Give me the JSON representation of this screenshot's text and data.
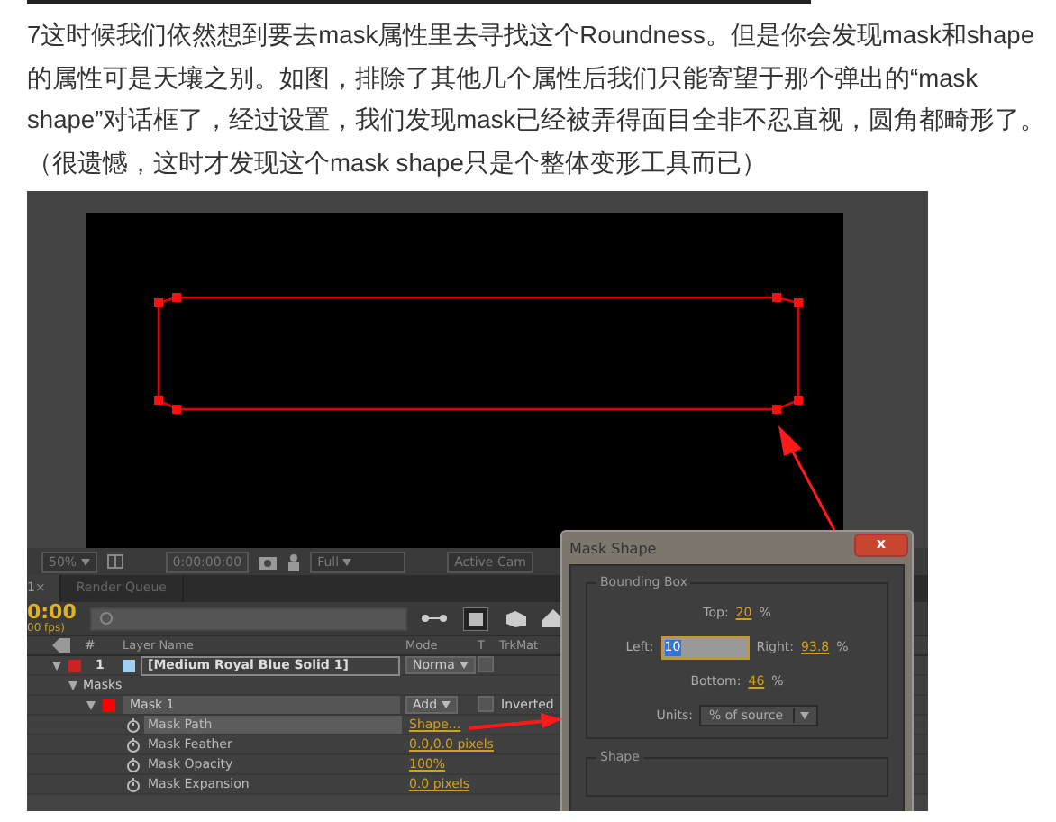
{
  "post": {
    "paragraphs": [
      "7这时候我们依然想到要去mask属性里去寻找这个Roundness。但是你会发现mask和shape的属性可是天壤之别。如图，排除了其他几个属性后我们只能寄望于那个弹出的“mask shape”对话框了，经过设置，我们发现mask已经被弄得面目全非不忍直视，圆角都畸形了。",
      "（很遗憾，这时才发现这个mask shape只是个整体变形工具而已）"
    ]
  },
  "screenshot": {
    "viewer_toolbar": {
      "zoom": "50%",
      "timecode": "0:00:00:00",
      "resolution": "Full",
      "camera": "Active Cam"
    },
    "tabs": [
      {
        "label": "1",
        "close": "×",
        "selected": true
      },
      {
        "label": "Render Queue",
        "selected": false
      }
    ],
    "timecode": "0:00",
    "fps": "00 fps)",
    "columns": [
      "#",
      "Layer Name",
      "Mode",
      "T",
      "TrkMat"
    ],
    "rows": [
      {
        "kind": "layer",
        "number": "1",
        "name": "[Medium Royal Blue Solid 1]",
        "mode": "Norma",
        "color": "#cc2222",
        "expanded": true,
        "selected": false,
        "checked": false
      },
      {
        "kind": "group",
        "name": "Masks",
        "expanded": true,
        "selected": false
      },
      {
        "kind": "mask",
        "name": "Mask 1",
        "mode": "Add",
        "option": "Inverted",
        "color": "#ff0000",
        "expanded": true,
        "selected": false,
        "checked": false
      },
      {
        "kind": "property",
        "name": "Mask Path",
        "value": "Shape...",
        "selected": true
      },
      {
        "kind": "property",
        "name": "Mask Feather",
        "value": "0.0,0.0 pixels",
        "selected": false
      },
      {
        "kind": "property",
        "name": "Mask Opacity",
        "value": "100%",
        "selected": false
      },
      {
        "kind": "property",
        "name": "Mask Expansion",
        "value": "0.0 pixels",
        "selected": false
      }
    ]
  },
  "mask_shape_dialog": {
    "title": "Mask Shape",
    "close": "x",
    "group": "Bounding Box",
    "top": {
      "label": "Top:",
      "value": "20",
      "unit": "%"
    },
    "left": {
      "label": "Left:",
      "value": "10"
    },
    "right": {
      "label": "Right:",
      "value": "93.8",
      "unit": "%"
    },
    "bottom": {
      "label": "Bottom:",
      "value": "46",
      "unit": "%"
    },
    "units": {
      "label": "Units:",
      "value": "% of source"
    },
    "second_group": "Shape"
  }
}
